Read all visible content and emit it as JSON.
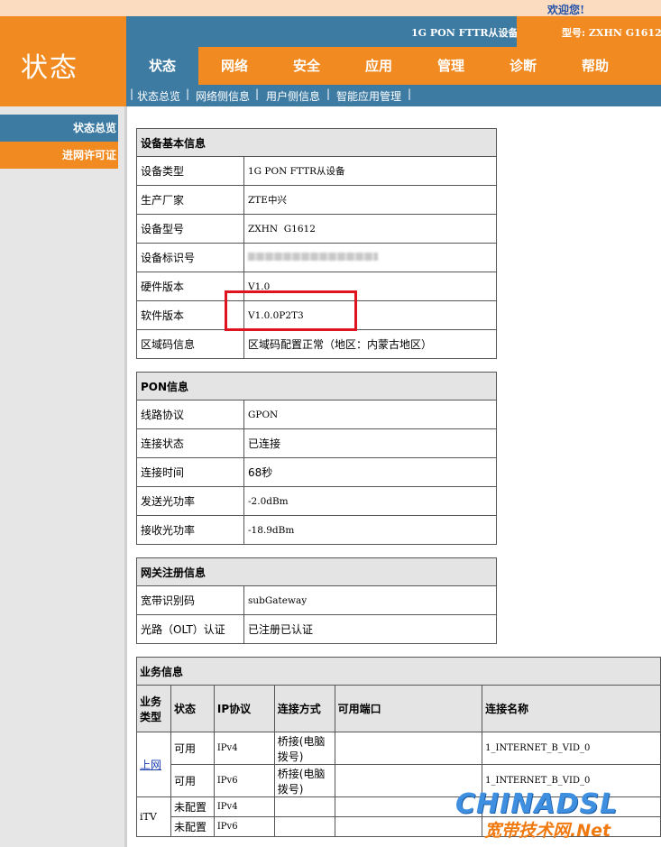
{
  "header": {
    "welcome": "欢迎您!",
    "brand_title": "状态",
    "device_name": "1G PON FTTR从设备",
    "model_text": "型号: ZXHN G1612"
  },
  "nav": {
    "tabs": [
      "状态",
      "网络",
      "安全",
      "应用",
      "管理",
      "诊断",
      "帮助"
    ],
    "active": "状态"
  },
  "subnav": [
    "状态总览",
    "网络侧信息",
    "用户侧信息",
    "智能应用管理"
  ],
  "sidebar": [
    "状态总览",
    "进网许可证"
  ],
  "device_info": {
    "title": "设备基本信息",
    "rows": [
      {
        "label": "设备类型",
        "value": "1G PON FTTR从设备"
      },
      {
        "label": "生产厂家",
        "value": "ZTE中兴"
      },
      {
        "label": "设备型号",
        "value": "ZXHN  G1612"
      },
      {
        "label": "设备标识号",
        "value": ""
      },
      {
        "label": "硬件版本",
        "value": "V1.0"
      },
      {
        "label": "软件版本",
        "value": "V1.0.0P2T3"
      },
      {
        "label": "区域码信息",
        "value": "区域码配置正常（地区：内蒙古地区）"
      }
    ]
  },
  "pon_info": {
    "title": "PON信息",
    "rows": [
      {
        "label": "线路协议",
        "value": "GPON"
      },
      {
        "label": "连接状态",
        "value": "已连接"
      },
      {
        "label": "连接时间",
        "value": "68秒"
      },
      {
        "label": "发送光功率",
        "value": "-2.0dBm"
      },
      {
        "label": "接收光功率",
        "value": "-18.9dBm"
      }
    ]
  },
  "gateway_info": {
    "title": "网关注册信息",
    "rows": [
      {
        "label": "宽带识别码",
        "value": "subGateway"
      },
      {
        "label": "光路（OLT）认证",
        "value": "已注册已认证"
      }
    ]
  },
  "business": {
    "title": "业务信息",
    "columns": [
      "业务类型",
      "状态",
      "IP协议",
      "连接方式",
      "可用端口",
      "连接名称"
    ],
    "groups": [
      {
        "type": "上网",
        "rows": [
          {
            "status": "可用",
            "ip": "IPv4",
            "conn": "桥接(电脑拨号)",
            "port": "",
            "name": "1_INTERNET_B_VID_0"
          },
          {
            "status": "可用",
            "ip": "IPv6",
            "conn": "桥接(电脑拨号)",
            "port": "",
            "name": "1_INTERNET_B_VID_0"
          }
        ]
      },
      {
        "type": "iTV",
        "rows": [
          {
            "status": "未配置",
            "ip": "IPv4",
            "conn": "",
            "port": "",
            "name": ""
          },
          {
            "status": "未配置",
            "ip": "IPv6",
            "conn": "",
            "port": "",
            "name": ""
          }
        ]
      }
    ]
  },
  "watermark": {
    "top": "CHINADSL",
    "bottom": "宽带技术网.Net"
  },
  "colors": {
    "orange": "#f08a21",
    "blue": "#3d7ba3",
    "highlight_red": "#e0141e"
  }
}
